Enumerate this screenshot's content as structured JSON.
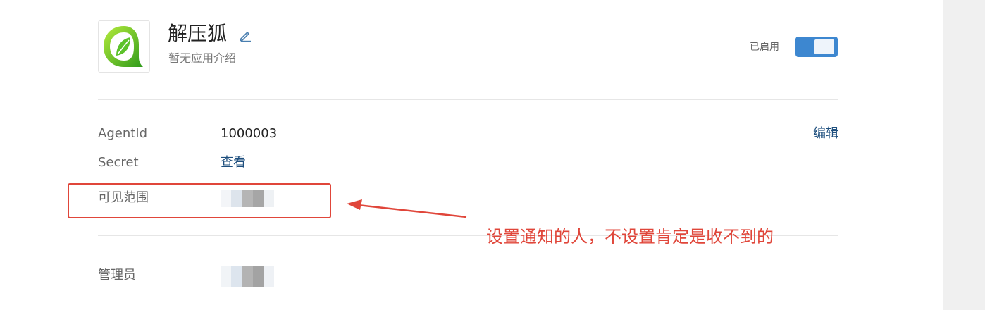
{
  "app": {
    "name": "解压狐",
    "description": "暂无应用介绍",
    "status_label": "已启用",
    "enabled": true,
    "logo_icon": "green-leaf-logo-icon"
  },
  "fields": {
    "agentid_label": "AgentId",
    "agentid_value": "1000003",
    "edit_label": "编辑",
    "secret_label": "Secret",
    "secret_link": "查看",
    "visible_scope_label": "可见范围",
    "admin_label": "管理员"
  },
  "annotation": {
    "text": "设置通知的人，不设置肯定是收不到的"
  },
  "colors": {
    "accent": "#3d87d0",
    "link": "#1e4f7e",
    "annotation_red": "#e0463a"
  }
}
